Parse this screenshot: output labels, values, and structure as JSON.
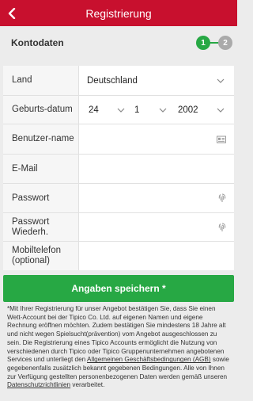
{
  "header": {
    "title": "Registrierung",
    "back_icon": "chevron-left-icon"
  },
  "section": {
    "title": "Kontodaten",
    "steps": [
      "1",
      "2"
    ],
    "active_step": 1,
    "accent": "#27a844"
  },
  "form": {
    "land": {
      "label": "Land",
      "value": "Deutschland"
    },
    "birth": {
      "label": "Geburts-datum",
      "day": "24",
      "month": "1",
      "year": "2002"
    },
    "username": {
      "label": "Benutzer-name",
      "value": ""
    },
    "email": {
      "label": "E-Mail",
      "value": ""
    },
    "password": {
      "label": "Passwort",
      "value": ""
    },
    "password_repeat": {
      "label": "Passwort Wiederh.",
      "value": ""
    },
    "mobile": {
      "label": "Mobiltelefon (optional)",
      "value": ""
    }
  },
  "save_button": {
    "label": "Angaben speichern *"
  },
  "legal": {
    "text_before_agb": "*Mit Ihrer Registrierung für unser Angebot bestätigen Sie, dass Sie einen Wett-Account bei der Tipico Co. Ltd. auf eigenen Namen und eigene Rechnung eröffnen möchten. Zudem bestätigen Sie mindestens 18 Jahre alt und nicht wegen Spielsucht(prävention) vom Angebot ausgeschlossen zu sein. Die Registrierung eines Tipico Accounts ermöglicht die Nutzung von verschiedenen durch Tipico oder Tipico Gruppenunternehmen angebotenen Services und unterliegt den ",
    "agb_link": "Allgemeinen Geschäftsbedingungen (AGB)",
    "text_between": " sowie gegebenenfalls zusätzlich bekannt gegebenen Bedingungen. Alle von Ihnen zur Verfügung gestellten personenbezogenen Daten werden gemäß unseren ",
    "privacy_link": "Datenschutzrichtlinien",
    "text_after": " verarbeitet."
  },
  "colors": {
    "brand": "#c8102e",
    "success": "#27a844",
    "inactive_step": "#aaaaaa"
  }
}
